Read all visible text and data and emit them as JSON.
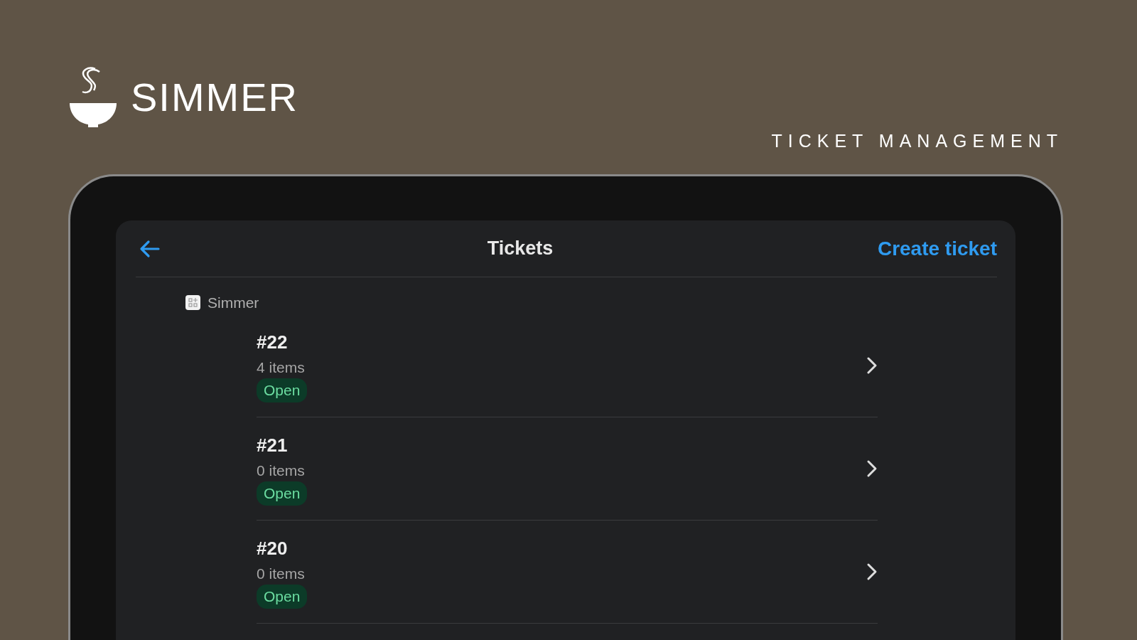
{
  "brand": {
    "name": "SIMMER",
    "tagline": "TICKET MANAGEMENT"
  },
  "screen": {
    "title": "Tickets",
    "action": "Create ticket",
    "group": "Simmer",
    "tickets": [
      {
        "number": "#22",
        "items": "4 items",
        "status": "Open"
      },
      {
        "number": "#21",
        "items": "0 items",
        "status": "Open"
      },
      {
        "number": "#20",
        "items": "0 items",
        "status": "Open"
      }
    ]
  }
}
